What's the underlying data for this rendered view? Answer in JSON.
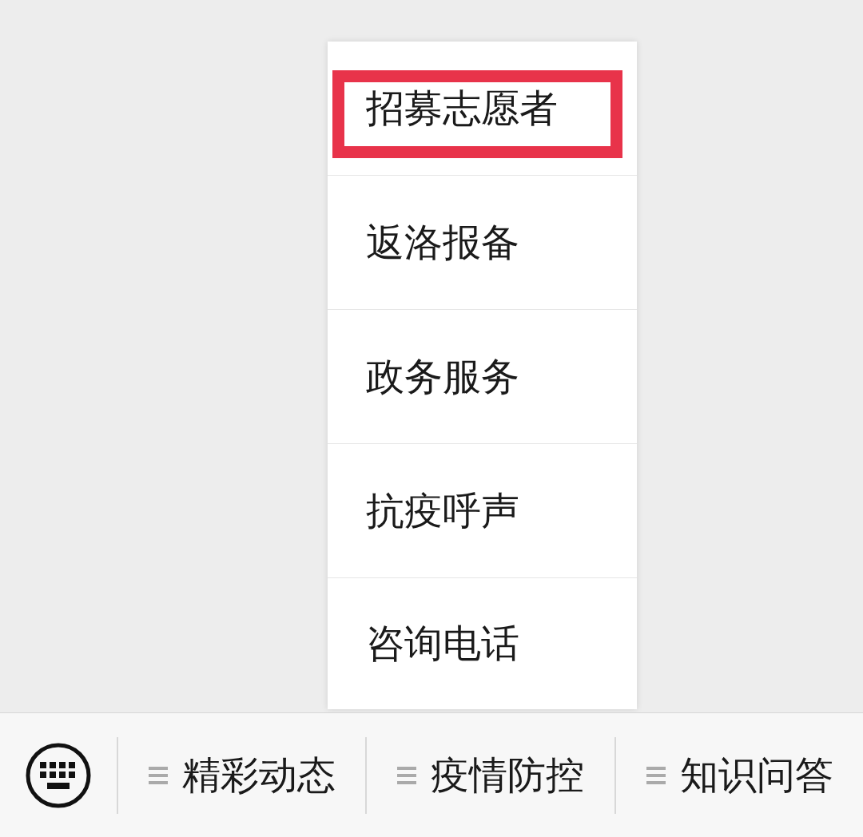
{
  "menu": {
    "items": [
      {
        "label": "招募志愿者",
        "highlighted": true
      },
      {
        "label": "返洛报备",
        "highlighted": false
      },
      {
        "label": "政务服务",
        "highlighted": false
      },
      {
        "label": "抗疫呼声",
        "highlighted": false
      },
      {
        "label": "咨询电话",
        "highlighted": false
      }
    ]
  },
  "bottom_bar": {
    "tabs": [
      {
        "label": "精彩动态"
      },
      {
        "label": "疫情防控"
      },
      {
        "label": "知识问答"
      }
    ]
  }
}
